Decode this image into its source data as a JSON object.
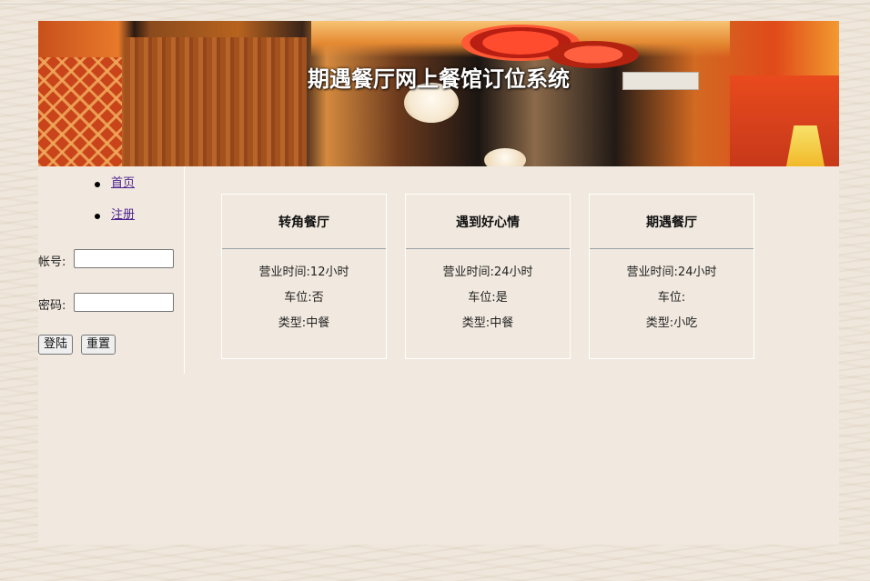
{
  "banner": {
    "title": "期遇餐厅网上餐馆订位系统"
  },
  "nav": {
    "items": [
      {
        "label": "首页"
      },
      {
        "label": "注册"
      }
    ],
    "link_color": "#4b1f8f"
  },
  "login": {
    "account_label": "帐号:",
    "account_value": "",
    "password_label": "密码:",
    "password_value": "",
    "login_button": "登陆",
    "reset_button": "重置"
  },
  "restaurants": [
    {
      "name": "转角餐厅",
      "hours_label": "营业时间:",
      "hours": "12小时",
      "parking_label": "车位:",
      "parking": "否",
      "type_label": "类型:",
      "type": "中餐"
    },
    {
      "name": "遇到好心情",
      "hours_label": "营业时间:",
      "hours": "24小时",
      "parking_label": "车位:",
      "parking": "是",
      "type_label": "类型:",
      "type": "中餐"
    },
    {
      "name": "期遇餐厅",
      "hours_label": "营业时间:",
      "hours": "24小时",
      "parking_label": "车位:",
      "parking": "",
      "type_label": "类型:",
      "type": "小吃"
    }
  ]
}
